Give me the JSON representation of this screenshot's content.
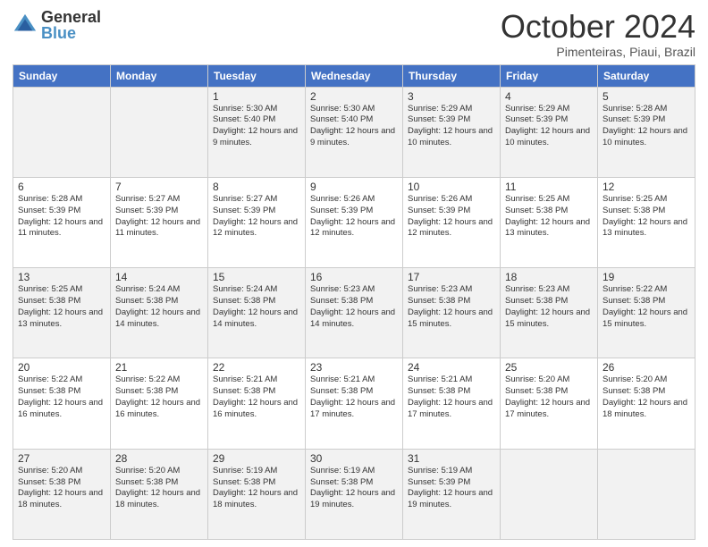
{
  "logo": {
    "general": "General",
    "blue": "Blue"
  },
  "header": {
    "month": "October 2024",
    "location": "Pimenteiras, Piaui, Brazil"
  },
  "weekdays": [
    "Sunday",
    "Monday",
    "Tuesday",
    "Wednesday",
    "Thursday",
    "Friday",
    "Saturday"
  ],
  "weeks": [
    [
      {
        "day": "",
        "info": ""
      },
      {
        "day": "",
        "info": ""
      },
      {
        "day": "1",
        "info": "Sunrise: 5:30 AM\nSunset: 5:40 PM\nDaylight: 12 hours and 9 minutes."
      },
      {
        "day": "2",
        "info": "Sunrise: 5:30 AM\nSunset: 5:40 PM\nDaylight: 12 hours and 9 minutes."
      },
      {
        "day": "3",
        "info": "Sunrise: 5:29 AM\nSunset: 5:39 PM\nDaylight: 12 hours and 10 minutes."
      },
      {
        "day": "4",
        "info": "Sunrise: 5:29 AM\nSunset: 5:39 PM\nDaylight: 12 hours and 10 minutes."
      },
      {
        "day": "5",
        "info": "Sunrise: 5:28 AM\nSunset: 5:39 PM\nDaylight: 12 hours and 10 minutes."
      }
    ],
    [
      {
        "day": "6",
        "info": "Sunrise: 5:28 AM\nSunset: 5:39 PM\nDaylight: 12 hours and 11 minutes."
      },
      {
        "day": "7",
        "info": "Sunrise: 5:27 AM\nSunset: 5:39 PM\nDaylight: 12 hours and 11 minutes."
      },
      {
        "day": "8",
        "info": "Sunrise: 5:27 AM\nSunset: 5:39 PM\nDaylight: 12 hours and 12 minutes."
      },
      {
        "day": "9",
        "info": "Sunrise: 5:26 AM\nSunset: 5:39 PM\nDaylight: 12 hours and 12 minutes."
      },
      {
        "day": "10",
        "info": "Sunrise: 5:26 AM\nSunset: 5:39 PM\nDaylight: 12 hours and 12 minutes."
      },
      {
        "day": "11",
        "info": "Sunrise: 5:25 AM\nSunset: 5:38 PM\nDaylight: 12 hours and 13 minutes."
      },
      {
        "day": "12",
        "info": "Sunrise: 5:25 AM\nSunset: 5:38 PM\nDaylight: 12 hours and 13 minutes."
      }
    ],
    [
      {
        "day": "13",
        "info": "Sunrise: 5:25 AM\nSunset: 5:38 PM\nDaylight: 12 hours and 13 minutes."
      },
      {
        "day": "14",
        "info": "Sunrise: 5:24 AM\nSunset: 5:38 PM\nDaylight: 12 hours and 14 minutes."
      },
      {
        "day": "15",
        "info": "Sunrise: 5:24 AM\nSunset: 5:38 PM\nDaylight: 12 hours and 14 minutes."
      },
      {
        "day": "16",
        "info": "Sunrise: 5:23 AM\nSunset: 5:38 PM\nDaylight: 12 hours and 14 minutes."
      },
      {
        "day": "17",
        "info": "Sunrise: 5:23 AM\nSunset: 5:38 PM\nDaylight: 12 hours and 15 minutes."
      },
      {
        "day": "18",
        "info": "Sunrise: 5:23 AM\nSunset: 5:38 PM\nDaylight: 12 hours and 15 minutes."
      },
      {
        "day": "19",
        "info": "Sunrise: 5:22 AM\nSunset: 5:38 PM\nDaylight: 12 hours and 15 minutes."
      }
    ],
    [
      {
        "day": "20",
        "info": "Sunrise: 5:22 AM\nSunset: 5:38 PM\nDaylight: 12 hours and 16 minutes."
      },
      {
        "day": "21",
        "info": "Sunrise: 5:22 AM\nSunset: 5:38 PM\nDaylight: 12 hours and 16 minutes."
      },
      {
        "day": "22",
        "info": "Sunrise: 5:21 AM\nSunset: 5:38 PM\nDaylight: 12 hours and 16 minutes."
      },
      {
        "day": "23",
        "info": "Sunrise: 5:21 AM\nSunset: 5:38 PM\nDaylight: 12 hours and 17 minutes."
      },
      {
        "day": "24",
        "info": "Sunrise: 5:21 AM\nSunset: 5:38 PM\nDaylight: 12 hours and 17 minutes."
      },
      {
        "day": "25",
        "info": "Sunrise: 5:20 AM\nSunset: 5:38 PM\nDaylight: 12 hours and 17 minutes."
      },
      {
        "day": "26",
        "info": "Sunrise: 5:20 AM\nSunset: 5:38 PM\nDaylight: 12 hours and 18 minutes."
      }
    ],
    [
      {
        "day": "27",
        "info": "Sunrise: 5:20 AM\nSunset: 5:38 PM\nDaylight: 12 hours and 18 minutes."
      },
      {
        "day": "28",
        "info": "Sunrise: 5:20 AM\nSunset: 5:38 PM\nDaylight: 12 hours and 18 minutes."
      },
      {
        "day": "29",
        "info": "Sunrise: 5:19 AM\nSunset: 5:38 PM\nDaylight: 12 hours and 18 minutes."
      },
      {
        "day": "30",
        "info": "Sunrise: 5:19 AM\nSunset: 5:38 PM\nDaylight: 12 hours and 19 minutes."
      },
      {
        "day": "31",
        "info": "Sunrise: 5:19 AM\nSunset: 5:39 PM\nDaylight: 12 hours and 19 minutes."
      },
      {
        "day": "",
        "info": ""
      },
      {
        "day": "",
        "info": ""
      }
    ]
  ]
}
